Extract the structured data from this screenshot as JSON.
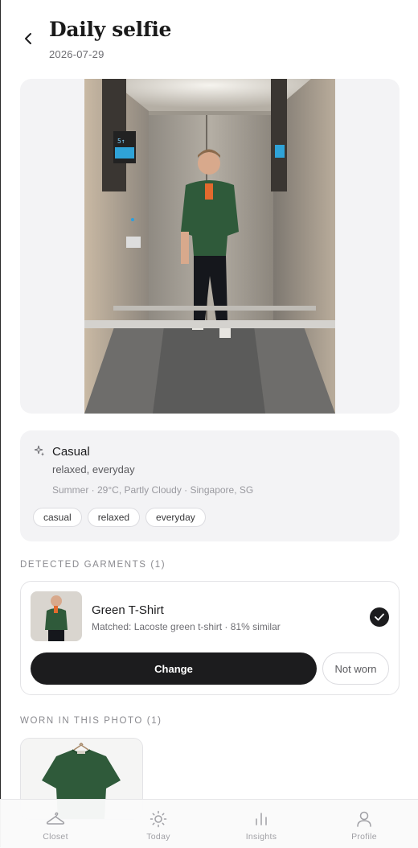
{
  "header": {
    "back_icon": "chevron-left-icon",
    "title": "Daily selfie",
    "date": "2026-07-29"
  },
  "photo": {
    "description_icon": "selfie-photo"
  },
  "style": {
    "icon": "sparkle-icon",
    "name": "Casual",
    "description": "relaxed, everyday",
    "meta": "Summer · 29°C, Partly Cloudy · Singapore, SG",
    "tags": [
      "casual",
      "relaxed",
      "everyday"
    ]
  },
  "detected": {
    "heading": "DETECTED GARMENTS (1)",
    "items": [
      {
        "name": "Green T-Shirt",
        "match": "Matched: Lacoste green t-shirt · 81% similar",
        "selected": true
      }
    ],
    "change_label": "Change",
    "not_worn_label": "Not worn"
  },
  "worn": {
    "heading": "WORN IN THIS PHOTO (1)"
  },
  "tabbar": {
    "tabs": [
      {
        "label": "Closet",
        "icon": "hanger-icon"
      },
      {
        "label": "Today",
        "icon": "sun-icon"
      },
      {
        "label": "Insights",
        "icon": "bar-chart-icon"
      },
      {
        "label": "Profile",
        "icon": "person-icon"
      }
    ]
  },
  "colors": {
    "primary": "#1c1c1e",
    "card_bg": "#f3f3f5",
    "shirt_green": "#2f5a3a"
  }
}
